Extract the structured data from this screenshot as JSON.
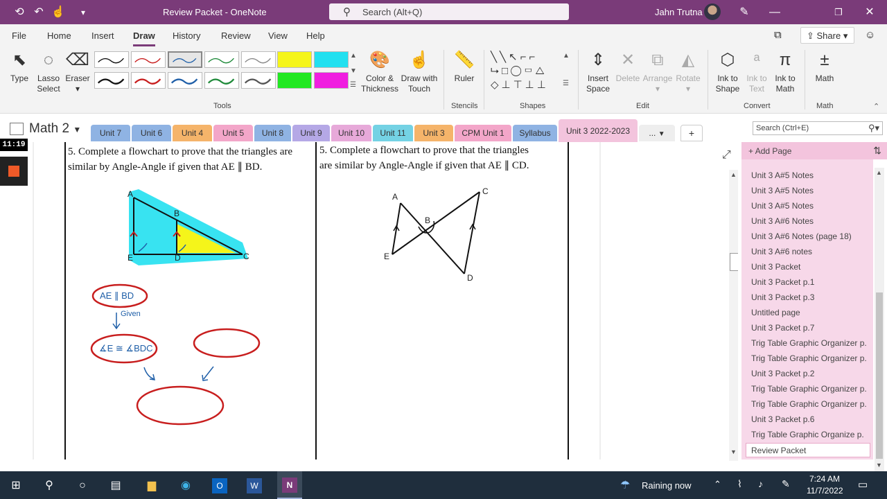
{
  "titlebar": {
    "title": "Review Packet - OneNote",
    "search_placeholder": "Search (Alt+Q)",
    "user": "Jahn Trutna"
  },
  "menu": [
    "File",
    "Home",
    "Insert",
    "Draw",
    "History",
    "Review",
    "View",
    "Help"
  ],
  "share_label": "Share",
  "ribbon": {
    "type": "Type",
    "lasso_1": "Lasso",
    "lasso_2": "Select",
    "eraser": "Eraser",
    "color_1": "Color &",
    "color_2": "Thickness",
    "touch_1": "Draw with",
    "touch_2": "Touch",
    "ruler": "Ruler",
    "insert_1": "Insert",
    "insert_2": "Space",
    "delete": "Delete",
    "arrange": "Arrange",
    "rotate": "Rotate",
    "ink_shape_1": "Ink to",
    "ink_shape_2": "Shape",
    "ink_text_1": "Ink to",
    "ink_text_2": "Text",
    "ink_math_1": "Ink to",
    "ink_math_2": "Math",
    "math": "Math",
    "groups": {
      "tools": "Tools",
      "stencils": "Stencils",
      "shapes": "Shapes",
      "edit": "Edit",
      "convert": "Convert",
      "math": "Math"
    }
  },
  "notebook": "Math 2",
  "sections": [
    "Unit 7",
    "Unit 6",
    "Unit 4",
    "Unit 5",
    "Unit 8",
    "Unit 9",
    "Unit 10",
    "Unit 11",
    "Unit 3",
    "CPM Unit 1",
    "Syllabus",
    "Unit 3 2022-2023",
    "..."
  ],
  "search_pages": "Search (Ctrl+E)",
  "recording_time": "11:19",
  "add_page": "Add Page",
  "pages": [
    "Unit 3 A#5 Notes",
    "Unit 3 A#5 Notes",
    "Unit 3 A#5 Notes",
    "Unit 3 A#6 Notes",
    "Unit 3 A#6 Notes (page 18)",
    "Unit 3 A#6 notes",
    "Unit 3 Packet",
    "Unit 3 Packet p.1",
    "Unit 3 Packet p.3",
    "Untitled page",
    "Unit 3 Packet p.7",
    "Trig Table Graphic Organizer p.",
    "Trig Table Graphic Organizer p.",
    "Unit 3 Packet p.2",
    "Trig Table Graphic Organizer p.",
    "Trig Table Graphic Organizer p.",
    "Unit 3 Packet p.6",
    "Trig Table Graphic Organize p.",
    "Review Packet"
  ],
  "problems": {
    "left_line1": "5. Complete a flowchart to prove that the triangles are",
    "left_line2": "similar by Angle-Angle if given that AE ∥ BD.",
    "right_line1": "5. Complete a flowchart to prove that the triangles",
    "right_line2": "are similar by Angle-Angle if given that AE ∥ CD."
  },
  "handwriting": {
    "given_stmt": "AE ∥ BD",
    "given_reason": "Given",
    "angle_stmt": "∡E ≅ ∡BDC"
  },
  "taskbar": {
    "weather": "Raining now",
    "time": "7:24 AM",
    "date": "11/7/2022"
  },
  "colors": {
    "titlebar": "#7a3b79",
    "onenote": "#7a3b79",
    "highlight_cyan": "#22e0f0",
    "highlight_yellow": "#f5f51a",
    "ink_red": "#c81e1e",
    "ink_blue": "#1f5fa8"
  }
}
